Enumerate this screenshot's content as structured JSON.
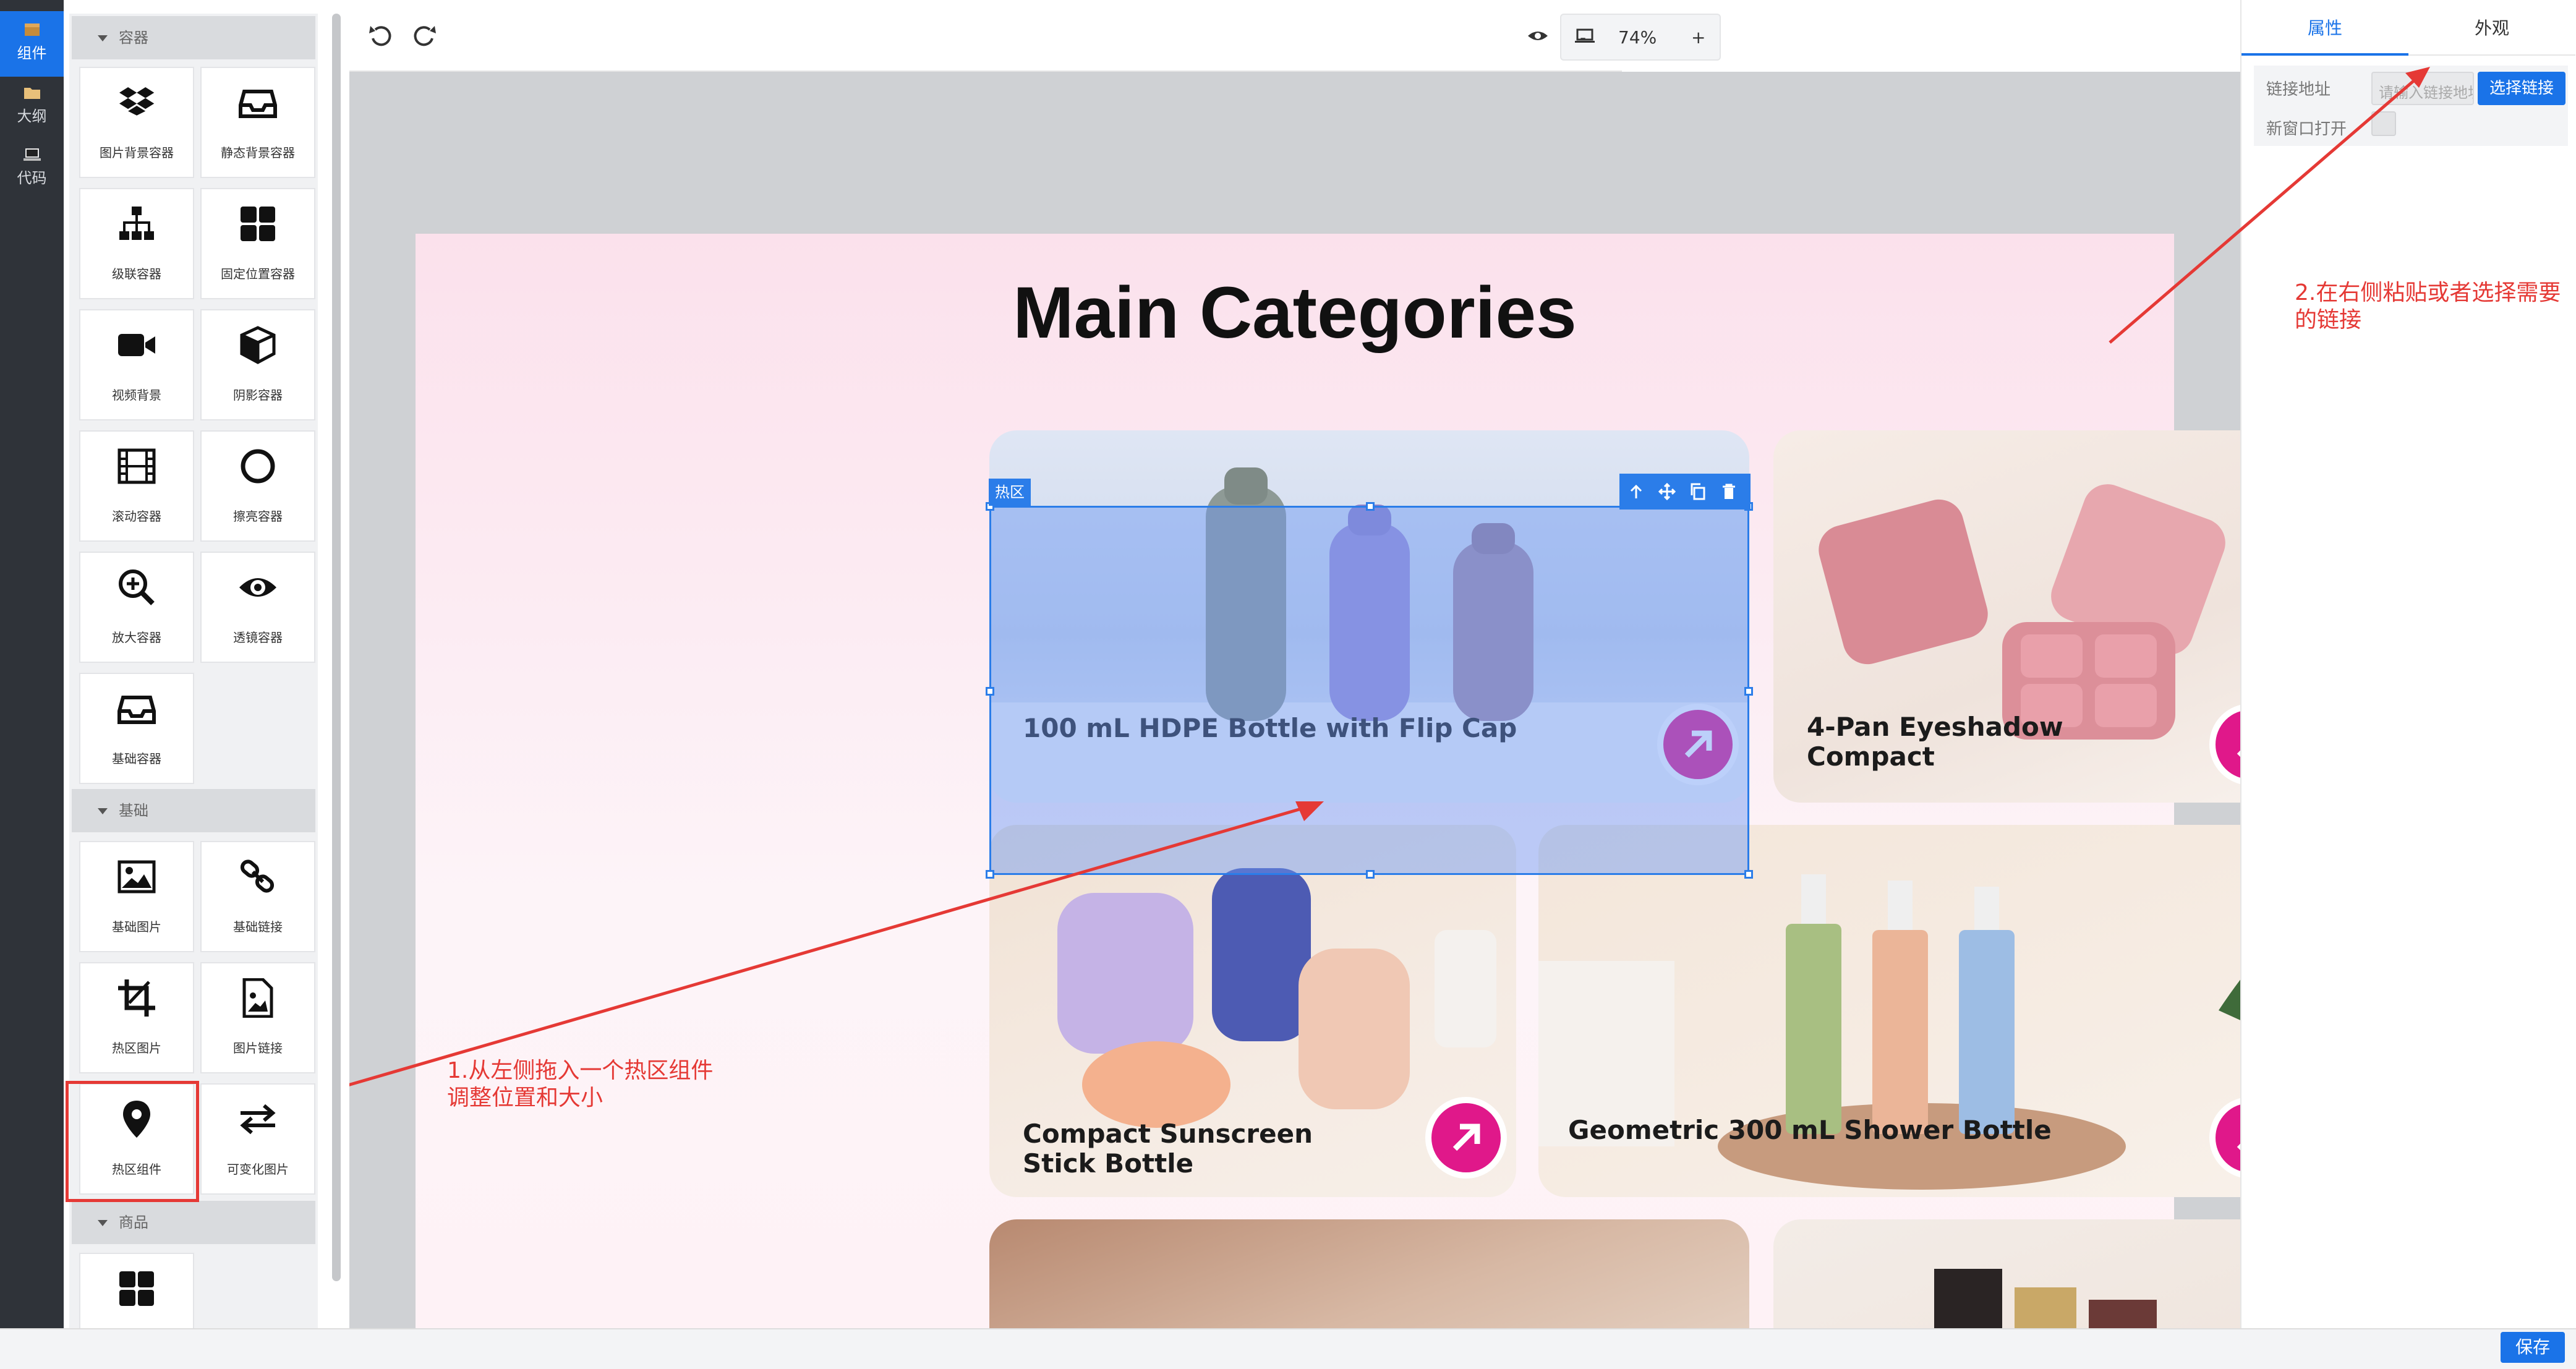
{
  "rail": {
    "components": "组件",
    "outline": "大纲",
    "code": "代码"
  },
  "panel": {
    "sections": [
      {
        "title": "容器"
      },
      {
        "title": "基础"
      },
      {
        "title": "商品"
      }
    ],
    "container_tiles": [
      {
        "label": "图片背景容器",
        "icon": "dropbox-icon"
      },
      {
        "label": "静态背景容器",
        "icon": "inbox-icon"
      },
      {
        "label": "级联容器",
        "icon": "sitemap-icon"
      },
      {
        "label": "固定位置容器",
        "icon": "grid-icon"
      },
      {
        "label": "视频背景",
        "icon": "video-icon"
      },
      {
        "label": "阴影容器",
        "icon": "cube-icon"
      },
      {
        "label": "滚动容器",
        "icon": "film-icon"
      },
      {
        "label": "擦亮容器",
        "icon": "circle-icon"
      },
      {
        "label": "放大容器",
        "icon": "zoom-in-icon"
      },
      {
        "label": "透镜容器",
        "icon": "eye-icon"
      },
      {
        "label": "基础容器",
        "icon": "inbox-icon"
      }
    ],
    "basic_tiles": [
      {
        "label": "基础图片",
        "icon": "image-icon"
      },
      {
        "label": "基础链接",
        "icon": "link-icon"
      },
      {
        "label": "热区图片",
        "icon": "crop-icon"
      },
      {
        "label": "图片链接",
        "icon": "file-image-icon"
      },
      {
        "label": "热区组件",
        "icon": "map-pin-icon"
      },
      {
        "label": "可变化图片",
        "icon": "exchange-icon"
      }
    ]
  },
  "toolbar": {
    "zoom_minus": "-",
    "zoom_value": "74%",
    "zoom_plus": "+"
  },
  "page": {
    "title": "Main Categories",
    "cards": [
      {
        "caption": "100 mL HDPE Bottle with Flip Cap"
      },
      {
        "caption_l1": "4-Pan Eyeshadow",
        "caption_l2": "Compact"
      },
      {
        "caption_l1": "Compact Sunscreen",
        "caption_l2": "Stick Bottle"
      },
      {
        "caption": "Geometric 300 mL Shower Bottle"
      }
    ],
    "hotzone_label": "热区"
  },
  "right_panel": {
    "tab_props": "属性",
    "tab_look": "外观",
    "link_label": "链接地址",
    "link_placeholder": "请输入链接地址",
    "select_link": "选择链接",
    "new_window": "新窗口打开"
  },
  "annotations": {
    "left_l1": "1.从左侧拖入一个热区组件",
    "left_l2": "调整位置和大小",
    "right_l1": "2.在右侧粘贴或者选择需要",
    "right_l2": "的链接"
  },
  "save": "保存",
  "colors": {
    "accent": "#1a73e8",
    "pink_arrow": "#e0188a",
    "annotation_red": "#e53935"
  }
}
